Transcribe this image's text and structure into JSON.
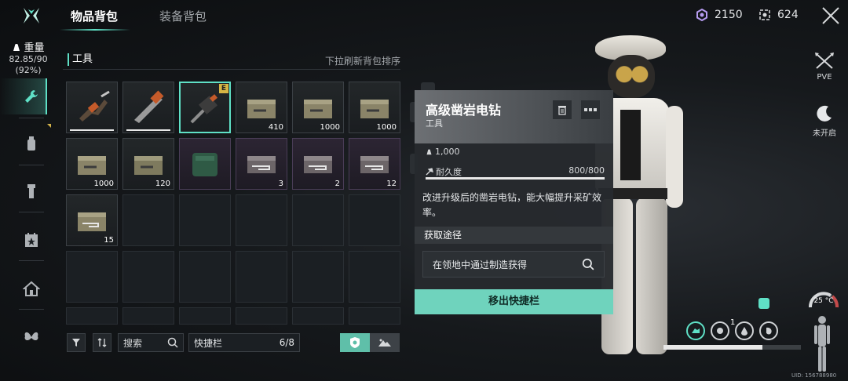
{
  "top": {
    "tabs": [
      {
        "label": "物品背包",
        "active": true
      },
      {
        "label": "装备背包",
        "active": false
      }
    ],
    "currency_1": "2150",
    "currency_2": "624"
  },
  "weight": {
    "label": "重量",
    "value": "82.85/90",
    "percent": "(92%)"
  },
  "section": {
    "title": "工具",
    "hint": "下拉刷新背包排序"
  },
  "grid": {
    "cells": [
      {
        "icon": "hand-drill-icon",
        "qty": "",
        "bar": true
      },
      {
        "icon": "chainsaw-icon",
        "qty": "",
        "bar": true
      },
      {
        "icon": "rock-drill-icon",
        "qty": "",
        "selected": true,
        "badge": "E"
      },
      {
        "icon": "ammo-crate-icon",
        "qty": "410"
      },
      {
        "icon": "ammo-crate-icon",
        "qty": "1000"
      },
      {
        "icon": "ammo-crate-icon",
        "qty": "1000"
      },
      {
        "icon": "ammo-crate-icon",
        "qty": "1000"
      },
      {
        "icon": "ammo-crate-icon",
        "qty": "120"
      },
      {
        "icon": "green-case-icon",
        "qty": "",
        "purple": true
      },
      {
        "icon": "weapon-case-icon",
        "qty": "3",
        "purple": true
      },
      {
        "icon": "weapon-case-icon",
        "qty": "2",
        "purple": true
      },
      {
        "icon": "weapon-case-icon",
        "qty": "12",
        "purple": true
      },
      {
        "icon": "ammo-crate-icon",
        "qty": "15"
      }
    ]
  },
  "toolbar": {
    "search_label": "搜索",
    "quickbar_label": "快捷栏",
    "quickbar_count": "6/8"
  },
  "detail": {
    "name": "高级凿岩电钻",
    "type": "工具",
    "weight": "1,000",
    "durability_label": "耐久度",
    "durability_value": "800/800",
    "description": "改进升级后的凿岩电钻，能大幅提升采矿效率。",
    "acquire_title": "获取途径",
    "acquire_item": "在领地中通过制造获得",
    "remove_button": "移出快捷栏"
  },
  "right": {
    "pve_label": "PVE",
    "night_label": "未开启",
    "temperature": "25 °C",
    "status_count": "1",
    "stamina_fraction": 0.72,
    "uid": "UID: 156788980"
  },
  "colors": {
    "accent": "#5fe0c6",
    "badge": "#d7b544",
    "purple_cell": "#2c2533"
  }
}
